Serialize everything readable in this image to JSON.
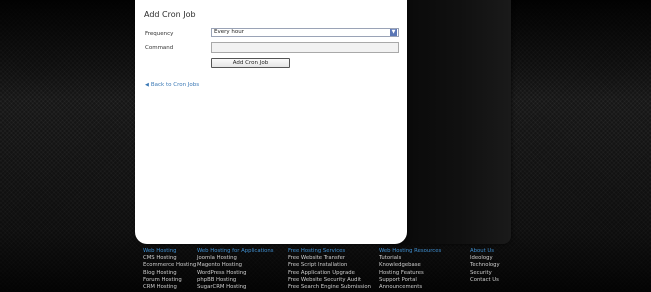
{
  "form": {
    "title": "Add Cron Job",
    "frequency_label": "Frequency",
    "frequency_value": "Every hour",
    "command_label": "Command",
    "command_value": "",
    "submit_label": "Add Cron Job",
    "back_link": "Back to Cron Jobs"
  },
  "footer": {
    "columns": [
      {
        "heading": "Web Hosting",
        "links": [
          "CMS Hosting",
          "Ecommerce Hosting",
          "Blog Hosting",
          "Forum Hosting",
          "CRM Hosting"
        ]
      },
      {
        "heading": "Web Hosting for Applications",
        "links": [
          "Joomla Hosting",
          "Magento Hosting",
          "WordPress Hosting",
          "phpBB Hosting",
          "SugarCRM Hosting"
        ]
      },
      {
        "heading": "Free Hosting Services",
        "links": [
          "Free Website Transfer",
          "Free Script Installation",
          "Free Application Upgrade",
          "Free Website Security Audit",
          "Free Search Engine Submission"
        ]
      },
      {
        "heading": "Web Hosting Resources",
        "links": [
          "Tutorials",
          "Knowledgebase",
          "Hosting Features",
          "Support Portal",
          "Announcements"
        ]
      },
      {
        "heading": "About Us",
        "links": [
          "Ideology",
          "Technology",
          "Security",
          "Contact Us"
        ]
      }
    ]
  },
  "colors": {
    "link": "#3a78b5",
    "footer_heading": "#3f8fd0",
    "footer_link": "#d0d0d0",
    "select_arrow": "#5b76b5"
  }
}
